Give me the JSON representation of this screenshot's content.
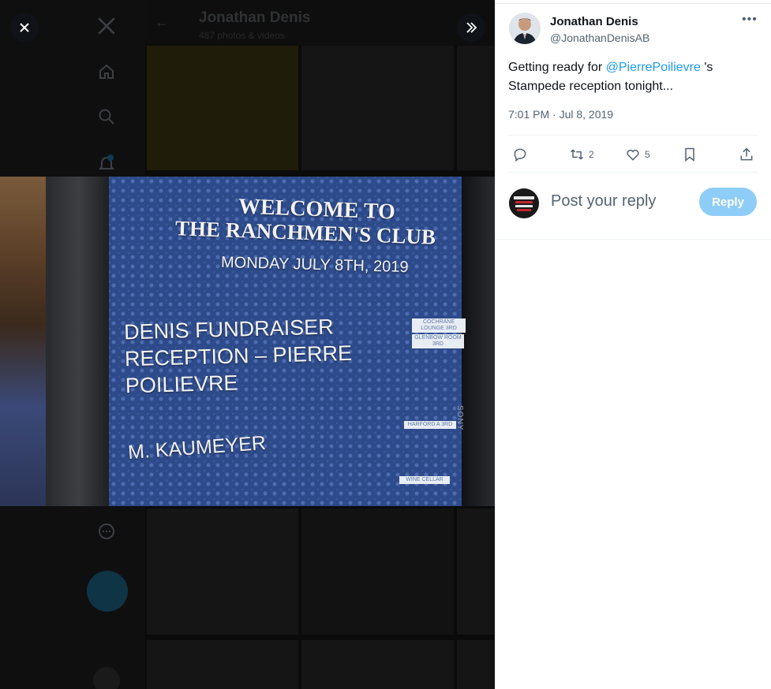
{
  "viewer": {
    "profile_title": "Jonathan Denis",
    "profile_subtitle": "487 photos & videos",
    "photo_sign": {
      "welcome": "WELCOME TO",
      "club": "THE RANCHMEN'S CLUB",
      "date": "MONDAY JULY 8TH, 2019",
      "event_1": "DENIS FUNDRAISER RECEPTION – PIERRE POILIEVRE",
      "event_2": "M. KAUMEYER",
      "room_1a": "COCHRANE LOUNGE 3RD",
      "room_1b": "GLENBOW ROOM 3RD",
      "room_2": "HARFORD A 3RD",
      "room_3": "WINE CELLAR",
      "tv_brand": "SONY"
    }
  },
  "tweet": {
    "author_name": "Jonathan Denis",
    "author_handle": "@JonathanDenisAB",
    "text_before": "Getting ready for ",
    "mention": "@PierrePoilievre",
    "text_after": " 's Stampede reception tonight...",
    "timestamp": "7:01 PM · Jul 8, 2019",
    "retweets": "2",
    "likes": "5"
  },
  "reply": {
    "placeholder": "Post your reply",
    "button": "Reply"
  },
  "icons": [
    "close-icon",
    "expand-icon",
    "x-logo-icon",
    "home-icon",
    "search-icon",
    "notifications-icon",
    "more-icon",
    "compose-icon",
    "back-arrow-icon",
    "more-options-icon",
    "reply-icon",
    "retweet-icon",
    "like-icon",
    "bookmark-icon",
    "share-icon"
  ],
  "colors": {
    "accent": "#1d9bf0",
    "reply_button": "#8ecdf8",
    "secondary_text": "#536471"
  }
}
